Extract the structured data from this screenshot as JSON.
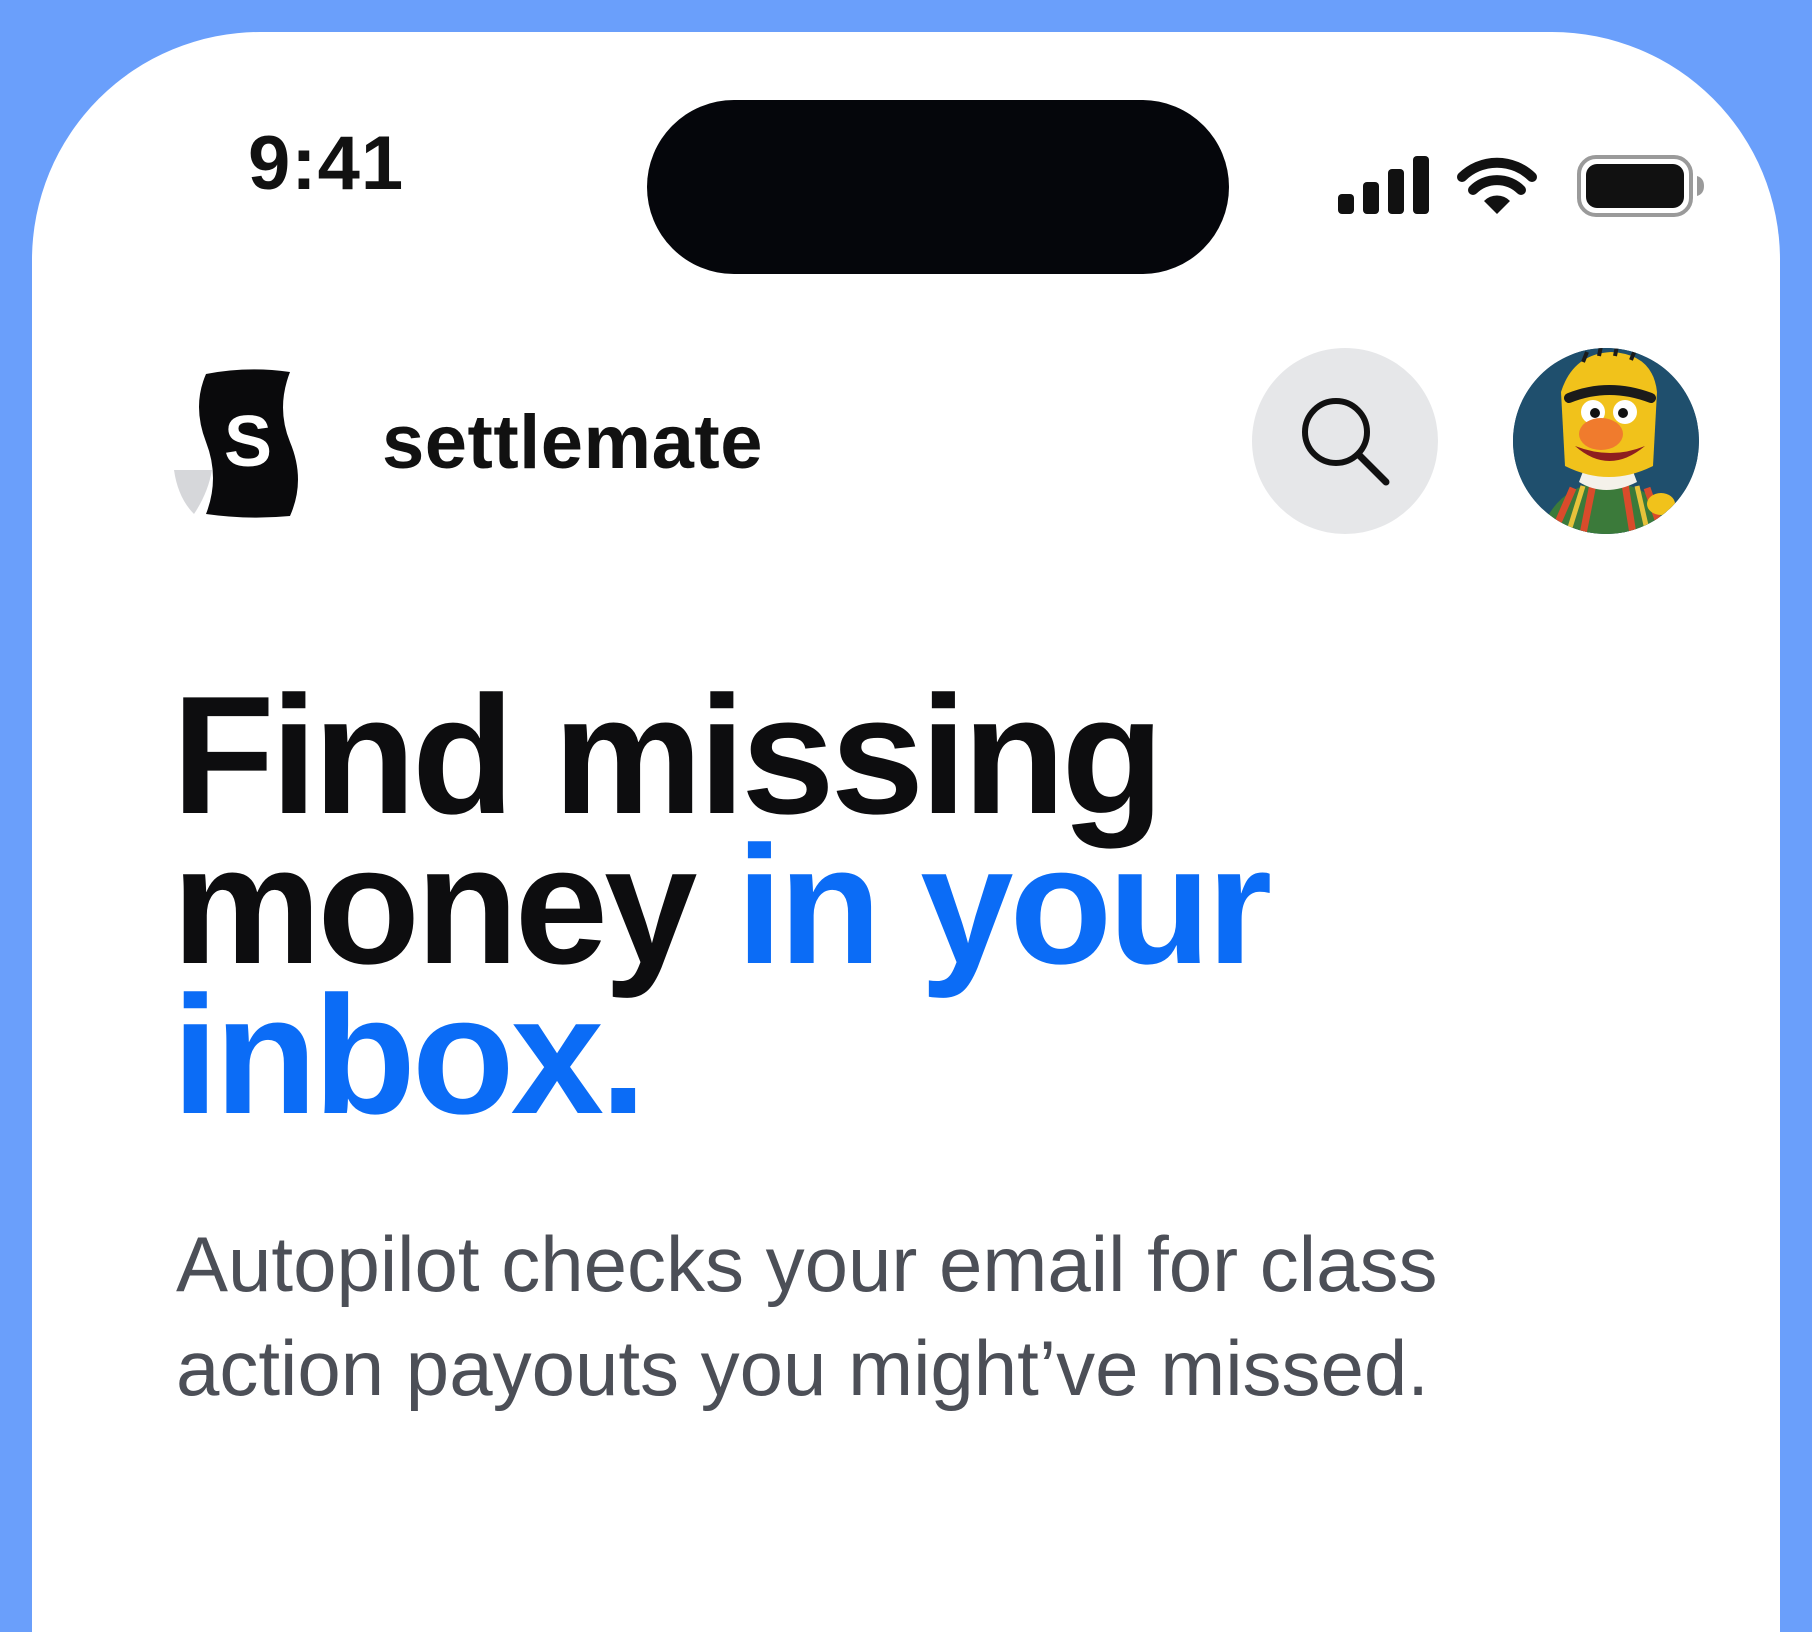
{
  "status_bar": {
    "time": "9:41",
    "icons": [
      "cellular-signal-icon",
      "wifi-icon",
      "battery-icon"
    ]
  },
  "header": {
    "logo_letter": "S",
    "brand_name": "settlemate",
    "search_icon": "search-icon",
    "avatar": "user-avatar"
  },
  "hero": {
    "headline_part1": "Find missing money ",
    "headline_accent": "in your inbox.",
    "subtext": "Autopilot checks your email for class action payouts you might’ve missed."
  },
  "colors": {
    "frame": "#6a9ffb",
    "accent": "#0b6cf6",
    "headline": "#0d0d0f",
    "subtext": "#4c4f57",
    "search_button_bg": "#e6e7e9"
  }
}
